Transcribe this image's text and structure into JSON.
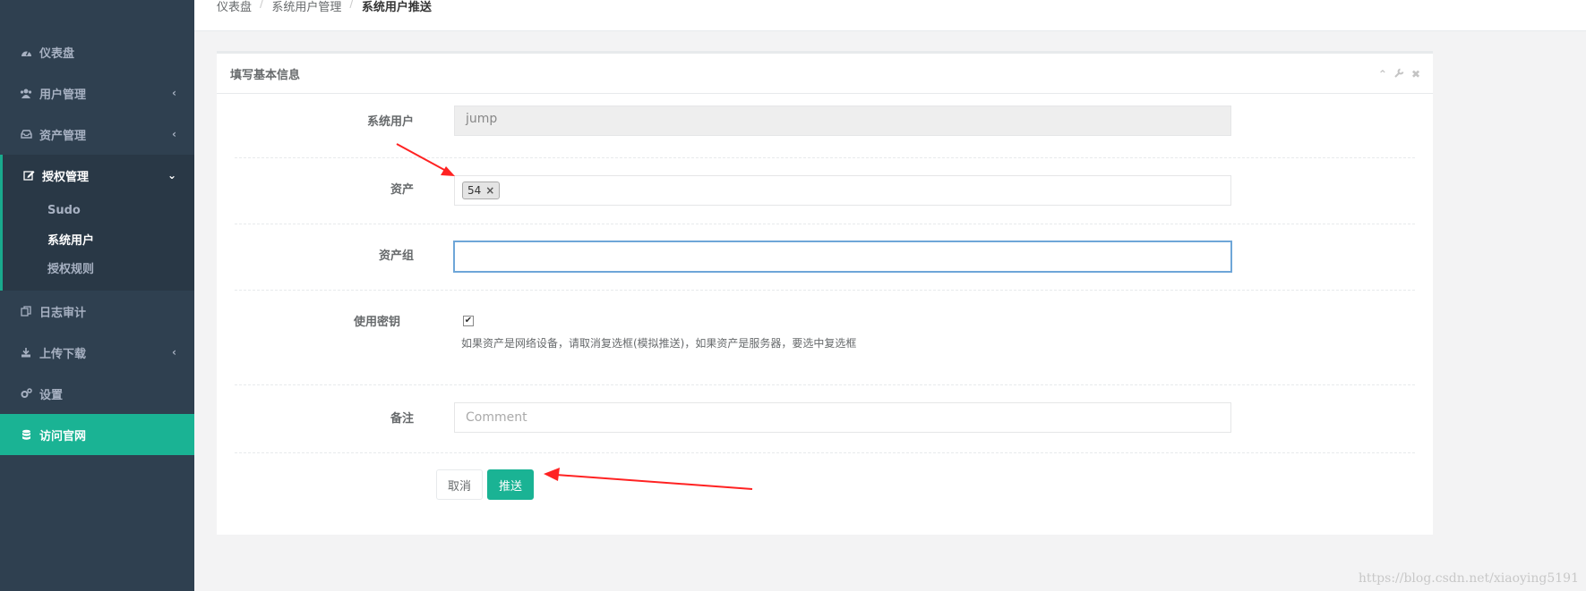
{
  "sidebar": {
    "items": [
      {
        "label": "仪表盘",
        "icon": "dashboard-icon"
      },
      {
        "label": "用户管理",
        "icon": "users-icon"
      },
      {
        "label": "资产管理",
        "icon": "inbox-icon"
      },
      {
        "label": "授权管理",
        "icon": "edit-icon"
      },
      {
        "label": "日志审计",
        "icon": "copy-icon"
      },
      {
        "label": "上传下载",
        "icon": "download-icon"
      },
      {
        "label": "设置",
        "icon": "cogs-icon"
      },
      {
        "label": "访问官网",
        "icon": "database-icon"
      }
    ],
    "sub_items": [
      "Sudo",
      "系统用户",
      "授权规则"
    ]
  },
  "breadcrumb": {
    "items": [
      "仪表盘",
      "系统用户管理",
      "系统用户推送"
    ]
  },
  "panel": {
    "title": "填写基本信息"
  },
  "form": {
    "system_user_label": "系统用户",
    "system_user_value": "jump",
    "asset_label": "资产",
    "asset_tag": "54",
    "asset_group_label": "资产组",
    "use_key_label": "使用密钥",
    "use_key_checked": true,
    "use_key_help": "如果资产是网络设备，请取消复选框(模拟推送)，如果资产是服务器，要选中复选框",
    "comment_label": "备注",
    "comment_placeholder": "Comment",
    "cancel_label": "取消",
    "push_label": "推送"
  },
  "watermark": "https://blog.csdn.net/xiaoying5191",
  "colors": {
    "sidebar_bg": "#2f4050",
    "accent": "#1ab394",
    "annotation_arrow": "#f22"
  }
}
